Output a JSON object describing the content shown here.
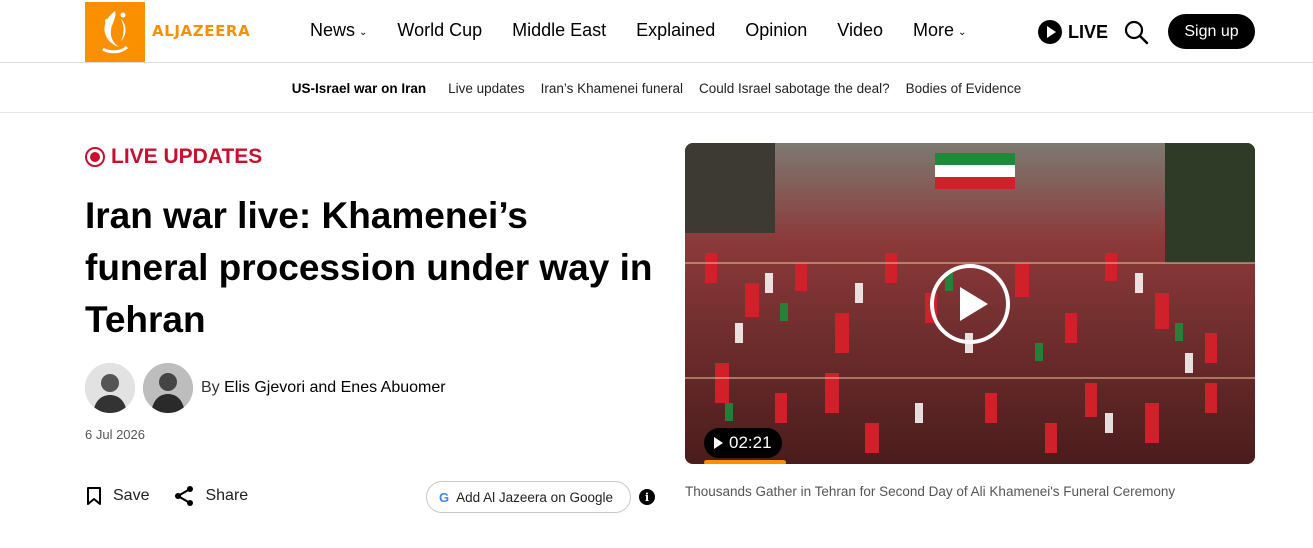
{
  "brand": {
    "name": "ALJAZEERA",
    "color": "#fa9000"
  },
  "nav": {
    "items": [
      {
        "label": "News",
        "dropdown": true
      },
      {
        "label": "World Cup",
        "dropdown": false
      },
      {
        "label": "Middle East",
        "dropdown": false
      },
      {
        "label": "Explained",
        "dropdown": false
      },
      {
        "label": "Opinion",
        "dropdown": false
      },
      {
        "label": "Video",
        "dropdown": false
      },
      {
        "label": "More",
        "dropdown": true
      }
    ],
    "live_label": "LIVE",
    "signup_label": "Sign up"
  },
  "subnav": {
    "title": "US-Israel war on Iran",
    "links": [
      "Live updates",
      "Iran’s Khamenei funeral",
      "Could Israel sabotage the deal?",
      "Bodies of Evidence"
    ]
  },
  "article": {
    "badge": "LIVE UPDATES",
    "headline": "Iran war live: Khamenei’s funeral procession under way in Tehran",
    "by_prefix": "By",
    "authors": "Elis Gjevori and Enes Abuomer",
    "date": "6 Jul 2026",
    "save_label": "Save",
    "share_label": "Share",
    "google_label": "Add Al Jazeera on Google",
    "google_letter": "G",
    "info_symbol": "i"
  },
  "video": {
    "duration": "02:21",
    "progress": 0.14,
    "caption": "Thousands Gather in Tehran for Second Day of Ali Khamenei's Funeral Ceremony"
  },
  "colors": {
    "accent_red": "#c8102e",
    "brand_orange": "#fa9000"
  },
  "icons": [
    "logo-icon",
    "chevron-down-icon",
    "play-icon",
    "search-icon",
    "live-dot-icon",
    "bookmark-icon",
    "share-icon",
    "google-icon",
    "info-icon"
  ]
}
